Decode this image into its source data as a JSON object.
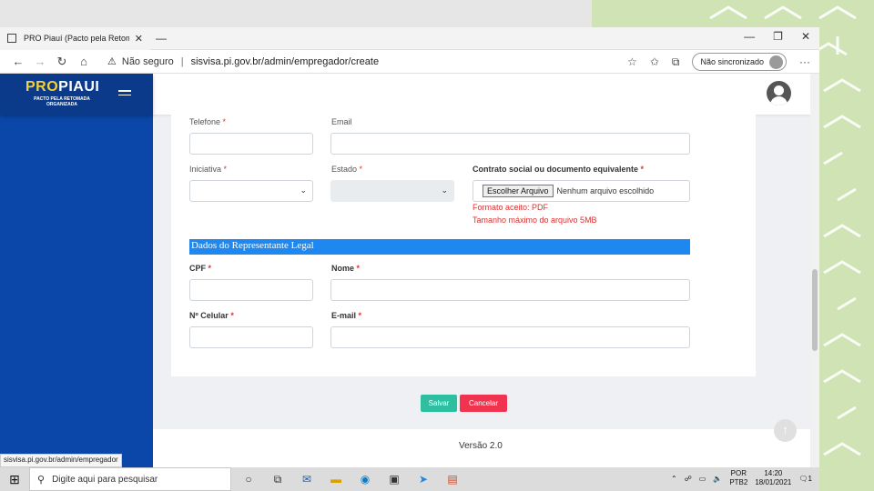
{
  "browser": {
    "tab_title": "PRO Piauí (Pacto pela Retomada",
    "tab_close": "✕",
    "tab_menu": "—",
    "win_minimize": "—",
    "win_maximize": "❐",
    "win_close": "✕",
    "security_label": "Não seguro",
    "url": "sisvisa.pi.gov.br/admin/empregador/create",
    "profile_label": "Não sincronizado",
    "more": "···",
    "status_url": "sisvisa.pi.gov.br/admin/empregador"
  },
  "brand": {
    "logo_pro": "PRO",
    "logo_rest": "PIAUI",
    "subtitle": "PACTO PELA RETOMADA ORGANIZADA"
  },
  "form": {
    "telefone": "Telefone",
    "email": "Email",
    "iniciativa": "Iniciativa",
    "estado": "Estado",
    "contrato": "Contrato social ou documento equivalente",
    "file_button": "Escolher Arquivo",
    "file_status": "Nenhum arquivo escolhido",
    "hint_format": "Formato aceito: PDF",
    "hint_size": "Tamanho máximo do arquivo 5MB",
    "section_title": "Dados do Representante Legal",
    "cpf": "CPF",
    "nome": "Nome",
    "celular": "Nº Celular",
    "email2": "E-mail",
    "required_mark": " *",
    "save": "Salvar",
    "cancel": "Cancelar"
  },
  "footer": {
    "version": "Versão 2.0"
  },
  "taskbar": {
    "search_placeholder": "Digite aqui para pesquisar",
    "lang": "POR",
    "layout": "PTB2",
    "time": "14:20",
    "date": "18/01/2021",
    "notif_count": "1"
  },
  "colors": {
    "sidebar": "#0a47a8",
    "section_bar": "#1e88f0",
    "save": "#2ebfa0",
    "cancel": "#f0344f",
    "hint": "#d9302f"
  }
}
